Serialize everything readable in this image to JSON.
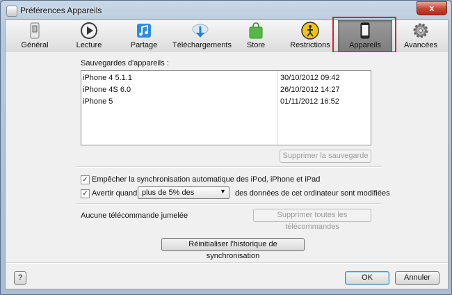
{
  "window": {
    "title": "Préférences Appareils",
    "close_symbol": "x"
  },
  "toolbar": {
    "tabs": [
      {
        "label": "Général",
        "icon": "switch-icon"
      },
      {
        "label": "Lecture",
        "icon": "play-icon"
      },
      {
        "label": "Partage",
        "icon": "music-share-icon"
      },
      {
        "label": "Téléchargements",
        "icon": "download-icon"
      },
      {
        "label": "Store",
        "icon": "shopping-bag-icon"
      },
      {
        "label": "Restrictions",
        "icon": "restriction-icon"
      },
      {
        "label": "Appareils",
        "icon": "device-icon",
        "selected": true
      },
      {
        "label": "Avancées",
        "icon": "gear-icon"
      }
    ]
  },
  "backups": {
    "label": "Sauvegardes d'appareils :",
    "rows": [
      {
        "device": "iPhone 4 5.1.1",
        "date": "30/10/2012 09:42"
      },
      {
        "device": "iPhone 4S 6.0",
        "date": "26/10/2012 14:27"
      },
      {
        "device": "iPhone 5",
        "date": "01/11/2012 16:52"
      }
    ],
    "delete_button": "Supprimer la sauvegarde"
  },
  "options": {
    "prevent_sync_label": "Empêcher la synchronisation automatique des iPod, iPhone et iPad",
    "prevent_sync_checked": true,
    "warn_label": "Avertir quand",
    "warn_checked": true,
    "warn_select_value": "plus de 5% des",
    "warn_suffix": "des données de cet ordinateur sont modifiées"
  },
  "remotes": {
    "label": "Aucune télécommande jumelée",
    "remove_button": "Supprimer toutes les télécommandes"
  },
  "reset_button": "Réinitialiser l'historique de synchronisation",
  "footer": {
    "help": "?",
    "ok": "OK",
    "cancel": "Annuler"
  },
  "colors": {
    "highlight": "#e0202a",
    "ok_border": "#3c7fb1"
  }
}
